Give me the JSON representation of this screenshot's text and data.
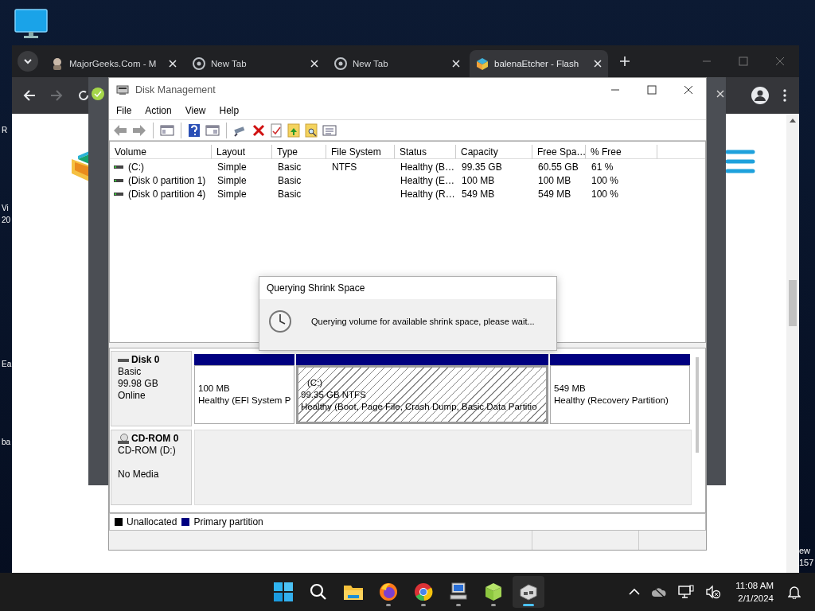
{
  "desktop": {
    "icon_labels_left": [
      {
        "lines": [
          "R"
        ]
      },
      {
        "lines": [
          "Vi",
          "20"
        ]
      },
      {
        "lines": [
          "Ea"
        ]
      },
      {
        "lines": [
          "ba"
        ]
      }
    ],
    "icon_labels_right": [
      {
        "lines": [
          "ew",
          "157"
        ]
      }
    ]
  },
  "browser": {
    "tabs": [
      {
        "kind": "majorgeeks",
        "title": "MajorGeeks.Com - M",
        "selected": false
      },
      {
        "kind": "chrome",
        "title": "New Tab",
        "selected": false
      },
      {
        "kind": "chrome",
        "title": "New Tab",
        "selected": false
      },
      {
        "kind": "etcher",
        "title": "balenaEtcher - Flash",
        "selected": true
      }
    ],
    "nav": [
      {
        "kind": "back",
        "disabled": false
      },
      {
        "kind": "forward",
        "disabled": true
      }
    ]
  },
  "disk_management": {
    "title": "Disk Management",
    "menu": [
      "File",
      "Action",
      "View",
      "Help"
    ],
    "columns": [
      "Volume",
      "Layout",
      "Type",
      "File System",
      "Status",
      "Capacity",
      "Free Spa…",
      "% Free"
    ],
    "volumes": [
      {
        "cells": [
          "(C:)",
          "Simple",
          "Basic",
          "NTFS",
          "Healthy (B…",
          "99.35 GB",
          "60.55 GB",
          "61 %"
        ]
      },
      {
        "cells": [
          "(Disk 0 partition 1)",
          "Simple",
          "Basic",
          "",
          "Healthy (E…",
          "100 MB",
          "100 MB",
          "100 %"
        ]
      },
      {
        "cells": [
          "(Disk 0 partition 4)",
          "Simple",
          "Basic",
          "",
          "Healthy (R…",
          "549 MB",
          "549 MB",
          "100 %"
        ]
      }
    ],
    "disks": [
      {
        "kind": "disk",
        "name": "Disk 0",
        "type": "Basic",
        "size": "99.98 GB",
        "status": "Online",
        "partitions": [
          {
            "size": "100 MB",
            "status": "Healthy (EFI System P",
            "selected": false
          },
          {
            "label": "(C:)",
            "size": "99.35 GB NTFS",
            "status": "Healthy (Boot, Page File, Crash Dump, Basic Data Partitio",
            "selected": true
          },
          {
            "size": "549 MB",
            "status": "Healthy (Recovery Partition)",
            "selected": false
          }
        ]
      },
      {
        "kind": "cdrom",
        "name": "CD-ROM 0",
        "type": "CD-ROM (D:)",
        "status": "No Media"
      }
    ],
    "legend": [
      {
        "label": "Unallocated",
        "color": "#000000"
      },
      {
        "label": "Primary partition",
        "color": "#000080"
      }
    ]
  },
  "dialog": {
    "title": "Querying Shrink Space",
    "message": "Querying volume for available shrink space, please wait..."
  },
  "taskbar": {
    "apps": [
      {
        "kind": "start",
        "running": false,
        "selected": false
      },
      {
        "kind": "search",
        "running": false,
        "selected": false
      },
      {
        "kind": "explorer",
        "running": false,
        "selected": false
      },
      {
        "kind": "firefox",
        "running": true,
        "selected": false
      },
      {
        "kind": "chrome",
        "running": true,
        "selected": false
      },
      {
        "kind": "computer",
        "running": true,
        "selected": false
      },
      {
        "kind": "etcher",
        "running": true,
        "selected": false
      },
      {
        "kind": "diskmgmt",
        "running": true,
        "selected": true
      }
    ],
    "clock": {
      "time": "11:08 AM",
      "date": "2/1/2024"
    }
  }
}
